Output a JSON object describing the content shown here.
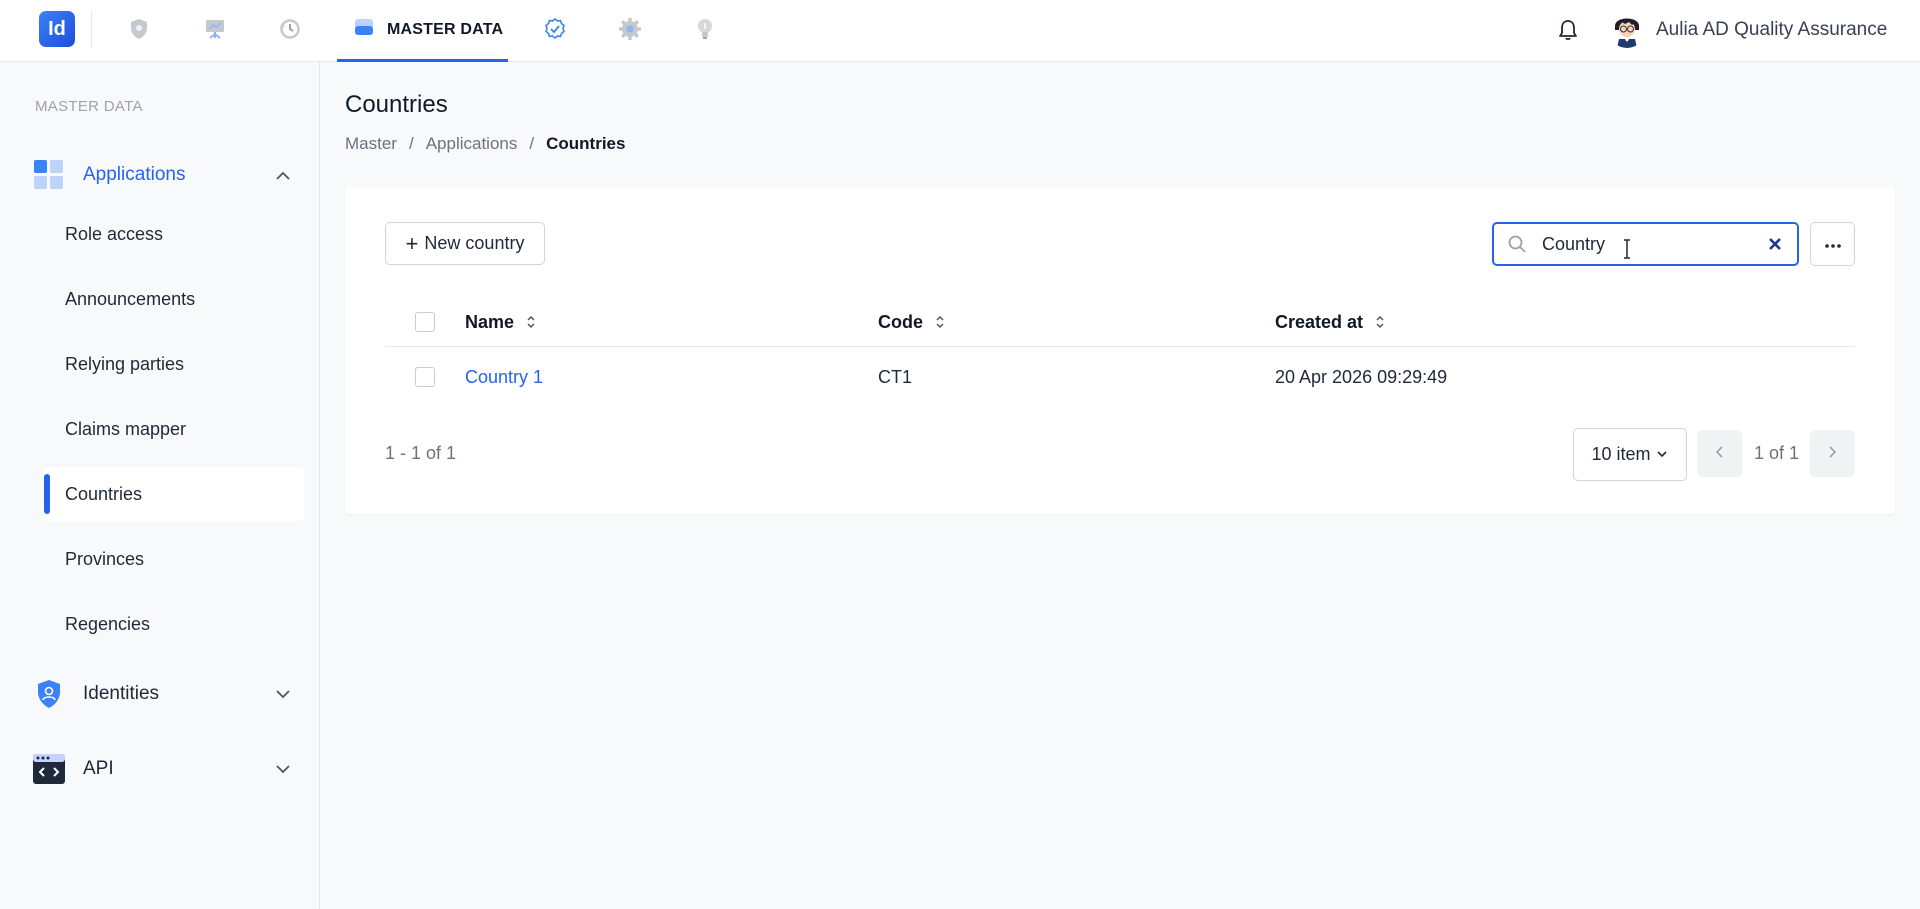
{
  "app": {
    "logo_text": "Id",
    "active_tab_label": "MASTER DATA",
    "nav_icons": [
      "shield-icon",
      "presentation-icon",
      "history-icon",
      "database-icon",
      "badge-check-icon",
      "gear-icon",
      "lightbulb-icon"
    ],
    "user_name": "Aulia AD Quality Assurance",
    "accent_color": "#2563eb"
  },
  "sidebar": {
    "heading": "MASTER DATA",
    "groups": [
      {
        "label": "Applications",
        "icon": "apps-grid-icon",
        "expanded": true,
        "items": [
          "Role access",
          "Announcements",
          "Relying parties",
          "Claims mapper",
          "Countries",
          "Provinces",
          "Regencies"
        ]
      },
      {
        "label": "Identities",
        "icon": "identity-shield-icon",
        "expanded": false
      },
      {
        "label": "API",
        "icon": "code-window-icon",
        "expanded": false
      }
    ],
    "active_item": "Countries"
  },
  "page": {
    "title": "Countries",
    "breadcrumb": [
      "Master",
      "Applications",
      "Countries"
    ]
  },
  "toolbar": {
    "new_label": "New country",
    "search_value": "Country"
  },
  "table": {
    "columns": [
      "Name",
      "Code",
      "Created at"
    ],
    "rows": [
      {
        "name": "Country 1",
        "code": "CT1",
        "created_at": "20 Apr 2026 09:29:49"
      }
    ]
  },
  "pagination": {
    "range_text": "1 - 1 of 1",
    "page_size_label": "10 item",
    "page_info": "1 of 1"
  }
}
